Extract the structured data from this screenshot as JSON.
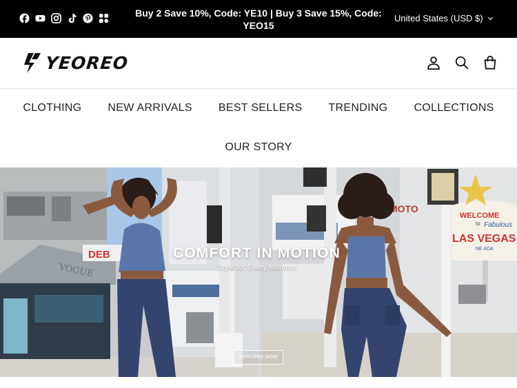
{
  "announcement": {
    "promo": "Buy 2 Save 10%, Code: YE10 | Buy 3 Save 15%, Code: YEO15",
    "currency": "United States (USD $)",
    "social_icons": [
      "facebook-icon",
      "youtube-icon",
      "instagram-icon",
      "tiktok-icon",
      "pinterest-icon",
      "app-icon"
    ]
  },
  "header": {
    "logo_text": "YEOREO",
    "icons": [
      "account-icon",
      "search-icon",
      "cart-icon"
    ]
  },
  "nav": {
    "items": [
      "CLOTHING",
      "NEW ARRIVALS",
      "BEST SELLERS",
      "TRENDING",
      "COLLECTIONS",
      "OUR STORY"
    ]
  },
  "hero": {
    "headline": "COMFORT IN MOTION",
    "subheadline": "Style for Every Moment",
    "cta": "EXPLORE NOW",
    "signs": {
      "vogue": "VOGUE",
      "deb": "DEB",
      "welcome": "WELCOME",
      "to": "to",
      "fabulous": "Fabulous",
      "las_vegas": "LAS VEGAS",
      "nevada": "NE   ADA",
      "moto": "MOTO"
    }
  },
  "colors": {
    "bar_bg": "#000000",
    "text": "#222222",
    "outfit_blue": "#5a76a8",
    "leggings_navy": "#34446e",
    "sky": "#a9c7e6"
  }
}
